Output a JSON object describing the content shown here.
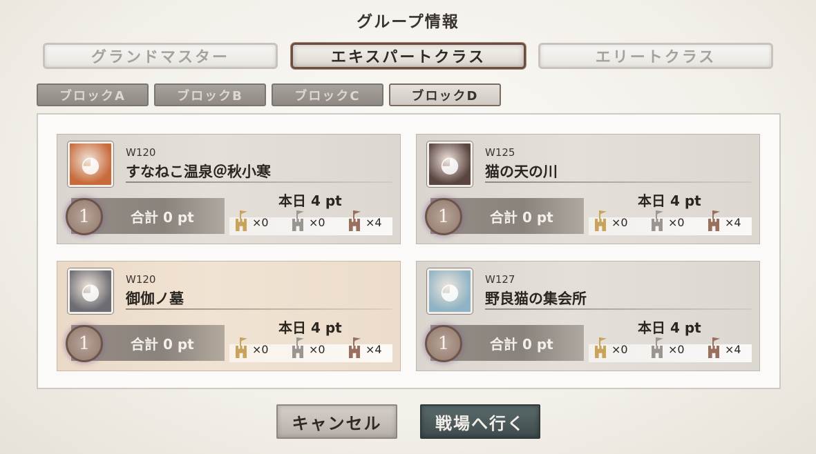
{
  "header": {
    "title": "グループ情報"
  },
  "class_tabs": [
    {
      "label": "グランドマスター",
      "state": "inactive"
    },
    {
      "label": "エキスパートクラス",
      "state": "active"
    },
    {
      "label": "エリートクラス",
      "state": "inactive"
    }
  ],
  "block_tabs": [
    {
      "label": "ブロックA",
      "state": "inactive"
    },
    {
      "label": "ブロックB",
      "state": "inactive"
    },
    {
      "label": "ブロックC",
      "state": "inactive"
    },
    {
      "label": "ブロックD",
      "state": "active"
    }
  ],
  "guilds": [
    {
      "server": "W120",
      "name": "すなねこ温泉＠秋小寒",
      "rank": "1",
      "total": "合計 0 pt",
      "today": "本日 4 pt",
      "gold": "×0",
      "silver": "×0",
      "bronze": "×4",
      "highlight": false,
      "avatar_color": "#c86a3a",
      "avatar_icon": "avatar-icon"
    },
    {
      "server": "W125",
      "name": "猫の天の川",
      "rank": "1",
      "total": "合計 0 pt",
      "today": "本日 4 pt",
      "gold": "×0",
      "silver": "×0",
      "bronze": "×4",
      "highlight": false,
      "avatar_color": "#5a4440",
      "avatar_icon": "avatar-icon"
    },
    {
      "server": "W120",
      "name": "御伽ノ墓",
      "rank": "1",
      "total": "合計 0 pt",
      "today": "本日 4 pt",
      "gold": "×0",
      "silver": "×0",
      "bronze": "×4",
      "highlight": true,
      "avatar_color": "#6c6c72",
      "avatar_icon": "avatar-icon"
    },
    {
      "server": "W127",
      "name": "野良猫の集会所",
      "rank": "1",
      "total": "合計 0 pt",
      "today": "本日 4 pt",
      "gold": "×0",
      "silver": "×0",
      "bronze": "×4",
      "highlight": false,
      "avatar_color": "#8fb3c4",
      "avatar_icon": "avatar-icon"
    }
  ],
  "buttons": {
    "cancel": "キャンセル",
    "go": "戦場へ行く"
  },
  "colors": {
    "gold": "#c9a35a",
    "silver": "#9a9590",
    "bronze": "#9b6f5e"
  }
}
